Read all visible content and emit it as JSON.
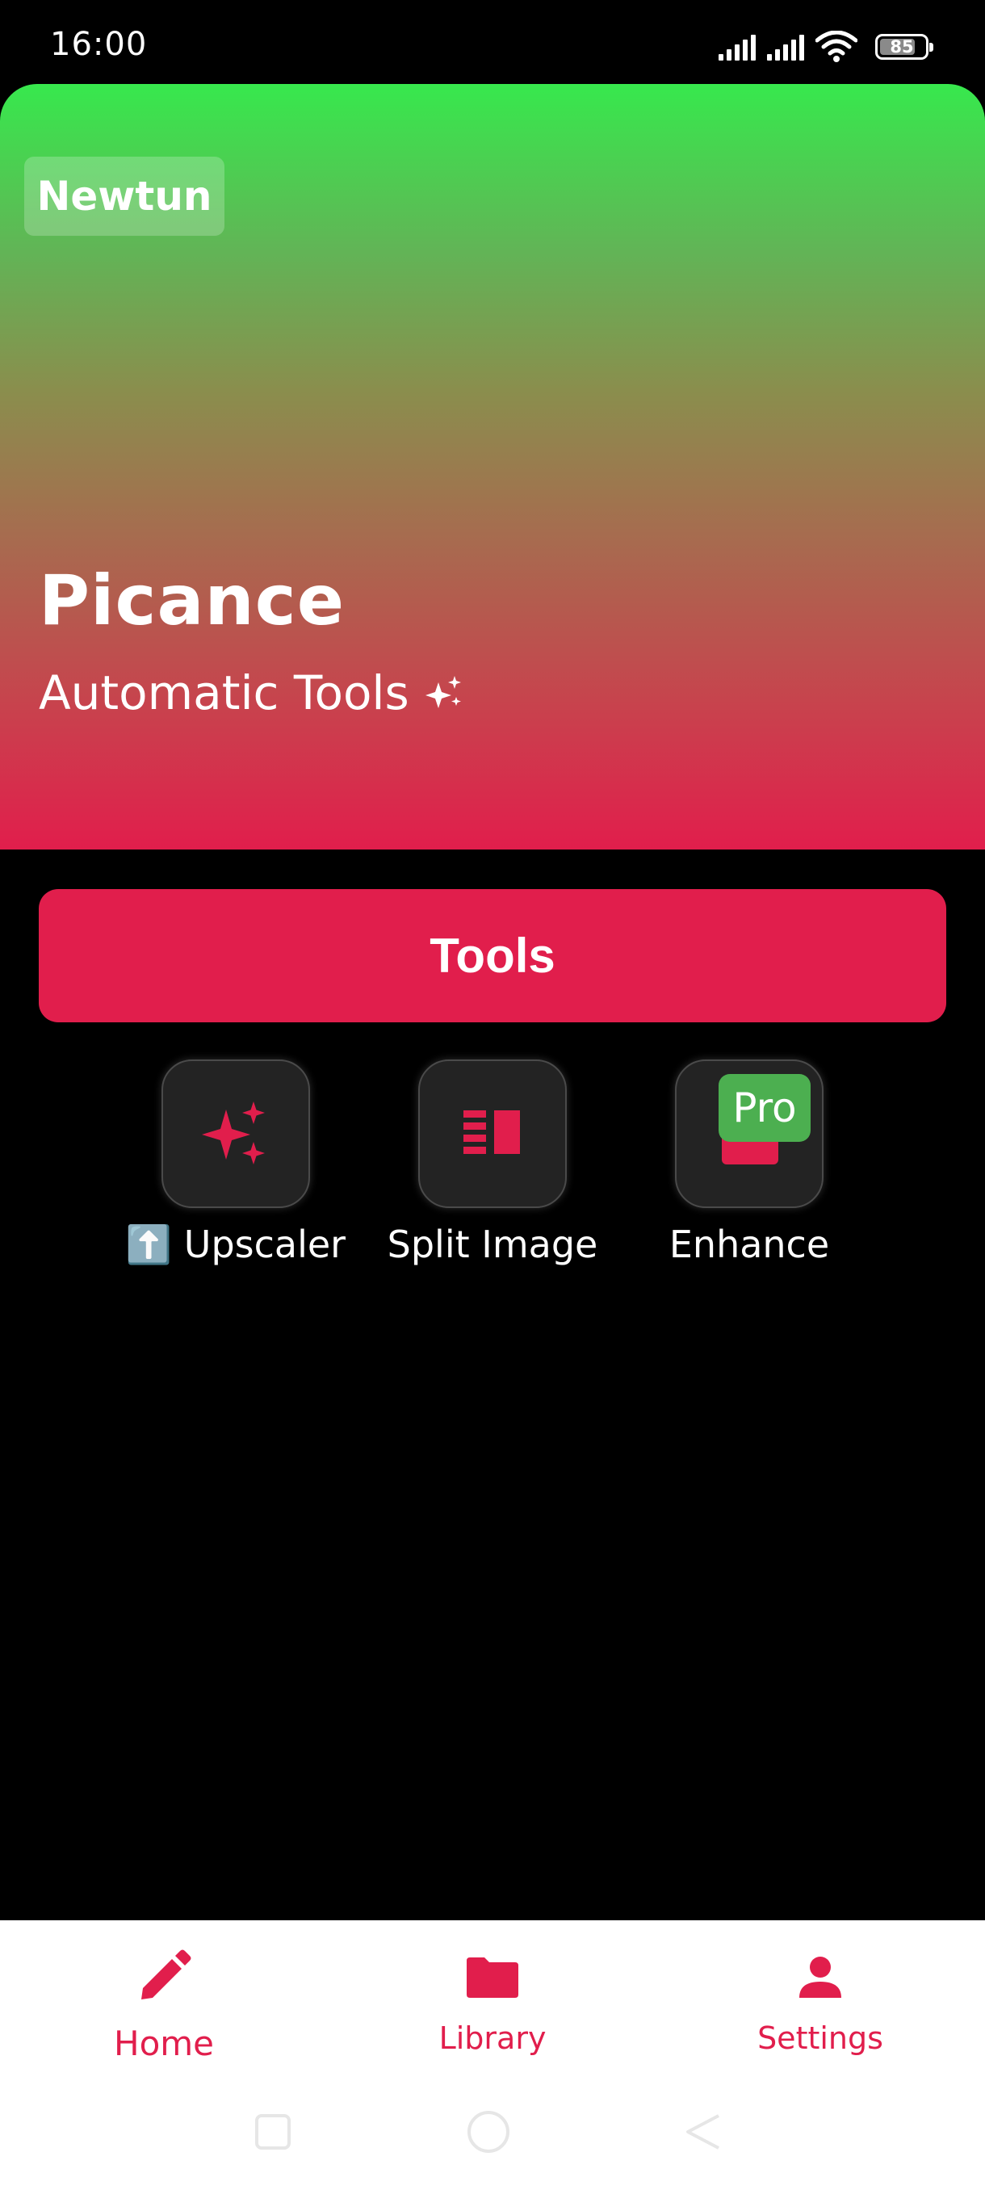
{
  "status_bar": {
    "time": "16:00",
    "battery": "85"
  },
  "hero": {
    "badge": "Newtun",
    "title": "Picance",
    "subtitle": "Automatic Tools"
  },
  "tools_button": {
    "label": "Tools"
  },
  "tools": [
    {
      "label": "⬆️ Upscaler",
      "icon": "sparkles-icon"
    },
    {
      "label": "Split Image",
      "icon": "split-image-icon"
    },
    {
      "label": "Enhance",
      "icon": "enhance-icon",
      "badge": "Pro"
    }
  ],
  "bottom_nav": {
    "items": [
      {
        "label": "Home",
        "icon": "pencil-icon",
        "active": true
      },
      {
        "label": "Library",
        "icon": "folder-icon",
        "active": false
      },
      {
        "label": "Settings",
        "icon": "person-icon",
        "active": false
      }
    ]
  },
  "colors": {
    "accent": "#e11e4c",
    "pro_badge": "#4caf50",
    "hero_top": "#37e84d",
    "hero_bottom": "#e11e4c"
  }
}
